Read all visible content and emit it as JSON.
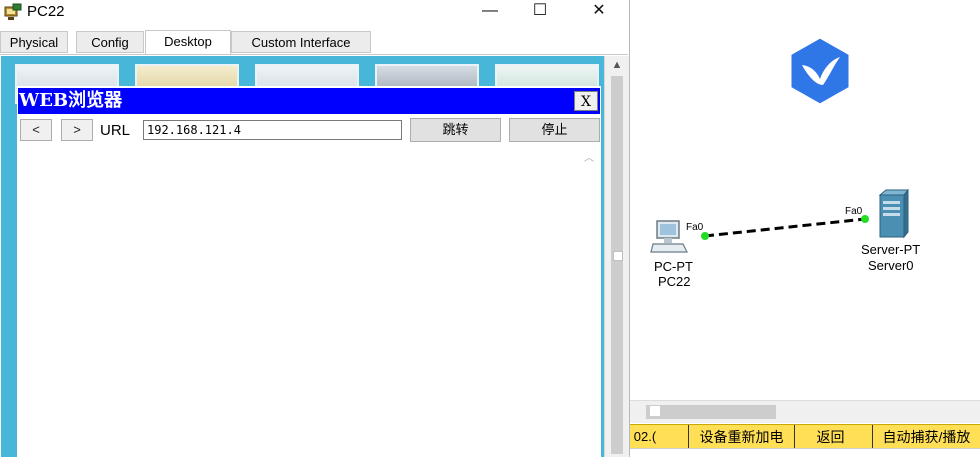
{
  "window": {
    "title": "PC22",
    "minimize_glyph": "—",
    "maximize_glyph": "☐",
    "close_glyph": "✕"
  },
  "tabs": [
    {
      "label": "Physical"
    },
    {
      "label": "Config"
    },
    {
      "label": "Desktop",
      "active": true
    },
    {
      "label": "Custom Interface"
    }
  ],
  "browser": {
    "title": "WEB浏览器",
    "close_label": "X",
    "back_label": "<",
    "forward_label": ">",
    "url_label": "URL",
    "url_value": "192.168.121.4",
    "go_label": "跳转",
    "stop_label": "停止"
  },
  "topology": {
    "pc": {
      "type": "PC-PT",
      "name": "PC22",
      "port": "Fa0"
    },
    "server": {
      "type": "Server-PT",
      "name": "Server0",
      "port": "Fa0"
    },
    "link_color": "#000000",
    "port_status_color": "#22dd22"
  },
  "statusbar": {
    "items": [
      "02.(",
      "设备重新加电",
      "返回",
      "自动捕获/播放"
    ]
  },
  "colors": {
    "desktop_bg": "#46b7d8",
    "browser_title_bg": "#0000ff",
    "statusbar_bg": "#ffdf56",
    "app_logo": "#2f76e6"
  }
}
